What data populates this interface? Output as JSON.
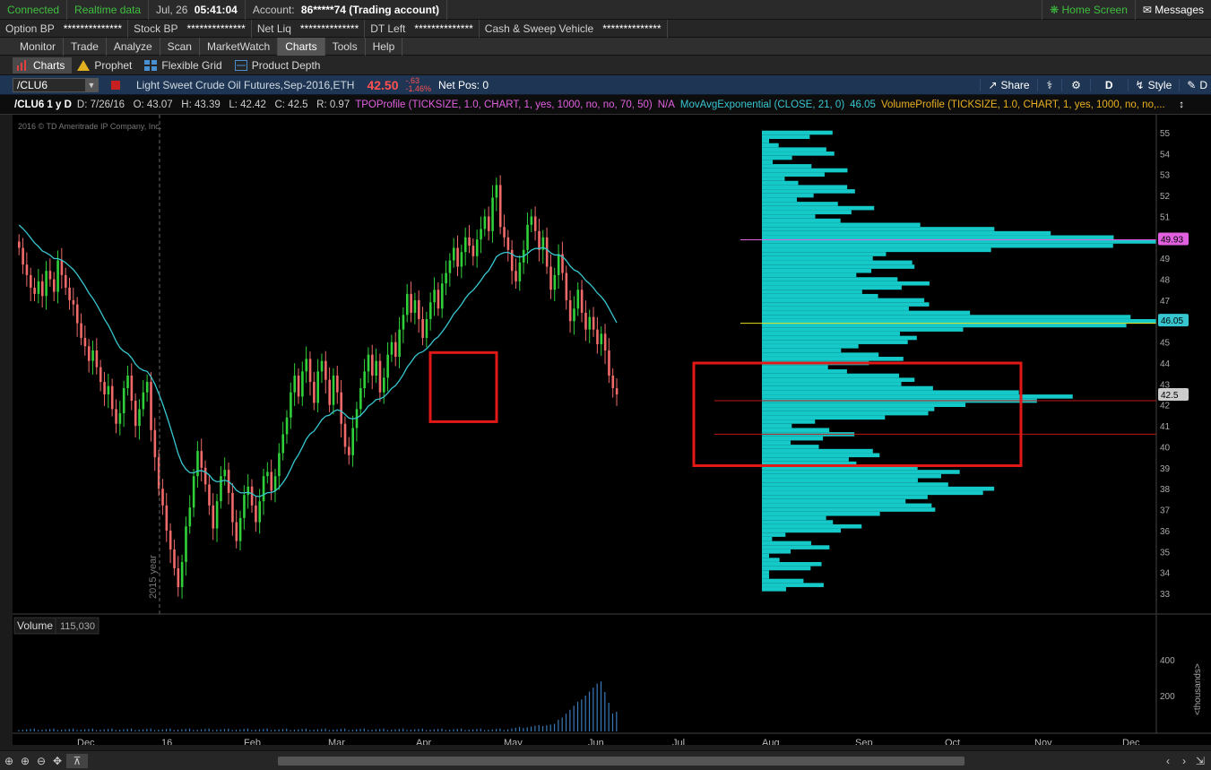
{
  "status": {
    "connected": "Connected",
    "realtime": "Realtime data",
    "date": "Jul, 26",
    "time": "05:41:04",
    "account_label": "Account:",
    "account_value": "86*****74 (Trading account)",
    "home_screen": "Home Screen",
    "messages": "Messages"
  },
  "account_bar": [
    {
      "label": "Option BP",
      "value": "**************"
    },
    {
      "label": "Stock BP",
      "value": "**************"
    },
    {
      "label": "Net Liq",
      "value": "**************"
    },
    {
      "label": "DT Left",
      "value": "**************"
    },
    {
      "label": "Cash & Sweep Vehicle",
      "value": "**************"
    }
  ],
  "main_tabs": [
    "Monitor",
    "Trade",
    "Analyze",
    "Scan",
    "MarketWatch",
    "Charts",
    "Tools",
    "Help"
  ],
  "active_main_tab": "Charts",
  "sub_tabs": [
    "Charts",
    "Prophet",
    "Flexible Grid",
    "Product Depth"
  ],
  "symbol_bar": {
    "symbol": "/CLU6",
    "description": "Light Sweet Crude Oil Futures,Sep-2016,ETH",
    "last": "42.50",
    "change": "-.63",
    "change_pct": "-1.46%",
    "net_pos": "Net Pos: 0",
    "share": "Share",
    "timeframe": "D",
    "style": "Style",
    "drawings": "D"
  },
  "study_bar": {
    "chart_title": "/CLU6 1 y D",
    "ohlc": "D: 7/26/16   O: 43.07   H: 43.39   L: 42.42   C: 42.5   R: 0.97",
    "tpo": "TPOProfile (TICKSIZE, 1.0, CHART, 1, yes, 1000, no, no, 70, 50)",
    "tpo_value": "N/A",
    "ema": "MovAvgExponential (CLOSE, 21, 0)",
    "ema_value": "46.05",
    "volume_profile": "VolumeProfile (TICKSIZE, 1.0, CHART, 1, yes, 1000, no, no,..."
  },
  "chart": {
    "copyright": "2016 © TD Ameritrade IP Company, Inc.",
    "year_marker": "2015 year",
    "volume_label": "Volume",
    "volume_value": "115,030",
    "volume_unit": "<thousands>",
    "price_labels": {
      "poc_high": "49.93",
      "ema": "46.05",
      "last": "42.5"
    },
    "colors": {
      "up": "#2fd03a",
      "down": "#f06a6a",
      "ema": "#38c6d0",
      "profile": "#19e5e5",
      "highlight": "#e01818"
    }
  },
  "chart_data": {
    "type": "candlestick",
    "title": "/CLU6 1 y D",
    "x_labels": [
      "Dec",
      "16",
      "Feb",
      "Mar",
      "Apr",
      "May",
      "Jun",
      "Jul",
      "Aug",
      "Sep",
      "Oct",
      "Nov",
      "Dec"
    ],
    "y_ticks": [
      33,
      34,
      35,
      36,
      37,
      38,
      39,
      40,
      41,
      42,
      43,
      44,
      45,
      46,
      47,
      48,
      49,
      50,
      51,
      52,
      53,
      54,
      55
    ],
    "ylim": [
      32,
      56
    ],
    "closes": [
      49.5,
      48.7,
      48.2,
      47.6,
      47.3,
      47.9,
      47.2,
      48.4,
      48.0,
      47.4,
      48.9,
      48.2,
      47.6,
      47.0,
      46.8,
      45.9,
      45.2,
      44.8,
      44.1,
      44.6,
      43.8,
      43.1,
      42.5,
      42.9,
      41.8,
      41.1,
      41.6,
      42.8,
      43.4,
      42.2,
      41.0,
      41.8,
      42.6,
      43.1,
      40.8,
      39.5,
      38.0,
      37.2,
      36.0,
      35.1,
      34.2,
      33.3,
      34.5,
      36.2,
      37.1,
      38.6,
      39.8,
      39.0,
      38.2,
      37.2,
      36.1,
      37.4,
      38.6,
      38.9,
      37.8,
      36.4,
      35.5,
      36.6,
      37.7,
      38.1,
      37.2,
      36.4,
      37.4,
      38.6,
      38.8,
      37.9,
      38.6,
      39.7,
      40.6,
      41.4,
      42.6,
      43.4,
      42.4,
      43.6,
      44.2,
      43.1,
      42.1,
      43.6,
      44.1,
      43.2,
      42.0,
      43.4,
      42.6,
      41.1,
      40.0,
      39.6,
      40.9,
      41.8,
      42.8,
      43.6,
      44.4,
      43.4,
      44.1,
      42.6,
      43.3,
      44.4,
      45.0,
      44.3,
      45.6,
      46.3,
      47.3,
      46.4,
      47.0,
      46.1,
      45.2,
      46.1,
      46.9,
      47.5,
      46.6,
      47.8,
      48.3,
      48.9,
      49.5,
      48.6,
      49.3,
      50.0,
      49.6,
      49.1,
      49.9,
      50.4,
      51.0,
      50.3,
      51.9,
      52.5,
      50.5,
      50.0,
      49.4,
      48.4,
      47.9,
      48.8,
      49.4,
      50.6,
      51.0,
      50.3,
      49.4,
      50.0,
      48.6,
      47.5,
      48.2,
      49.2,
      48.3,
      47.0,
      46.0,
      46.6,
      47.5,
      46.4,
      45.6,
      46.2,
      45.6,
      44.9,
      45.4,
      44.6,
      43.4,
      42.8,
      42.5
    ],
    "ema": {
      "name": "MovAvgExponential (CLOSE, 21, 0)",
      "last": 46.05
    },
    "volume": {
      "last": 115030,
      "unit": "thousands",
      "y_ticks": [
        200,
        400
      ]
    },
    "volume_profile": {
      "poc": 49.93,
      "highlight_range": [
        39.1,
        44.0
      ]
    }
  },
  "bottom_bar": {
    "zoom_in": "zoom-in",
    "zoom_out": "zoom-out"
  }
}
